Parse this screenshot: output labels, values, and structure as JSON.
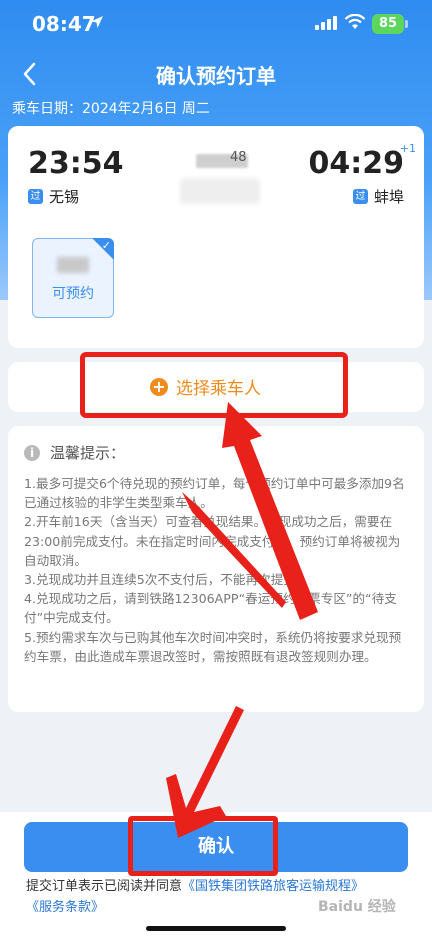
{
  "status_bar": {
    "time": "08:47",
    "battery": "85"
  },
  "nav": {
    "title": "确认预约订单"
  },
  "travel_date": "乘车日期：2024年2月6日 周二",
  "train": {
    "departure_time": "23:54",
    "arrival_time": "04:29",
    "day_offset": "+1",
    "train_no_visible": "48",
    "departure_station": "无锡",
    "arrival_station": "蚌埠",
    "station_tag": "过",
    "seat_status": "可预约"
  },
  "passenger": {
    "add_label": "选择乘车人",
    "add_symbol": "+"
  },
  "tips": {
    "title": "温馨提示：",
    "items": [
      "1.最多可提交6个待兑现的预约订单，每个预约订单中可最多添加9名已通过核验的非学生类型乘车人。",
      "2.开车前16天（含当天）可查看兑现结果。兑现成功之后，需要在23:00前完成支付。未在指定时间内完成支付的，预约订单将被视为自动取消。",
      "3.兑现成功并且连续5次不支付后，不能再次提交。",
      "4.兑现成功之后，请到铁路12306APP“春运预约订票专区”的“待支付”中完成支付。",
      "5.预约需求车次与已购其他车次时间冲突时，系统仍将按要求兑现预约车票，由此造成车票退改签时，需按照既有退改签规则办理。"
    ]
  },
  "footer": {
    "confirm_label": "确认",
    "agree_prefix": "提交订单表示已阅读并同意",
    "agree_link1": "《国铁集团铁路旅客运输规程》",
    "agree_link2": "《服务条款》",
    "watermark": "Baidu 经验"
  },
  "colors": {
    "primary": "#3a8ef0",
    "accent": "#ef8b1c",
    "highlight": "#e8211a"
  }
}
